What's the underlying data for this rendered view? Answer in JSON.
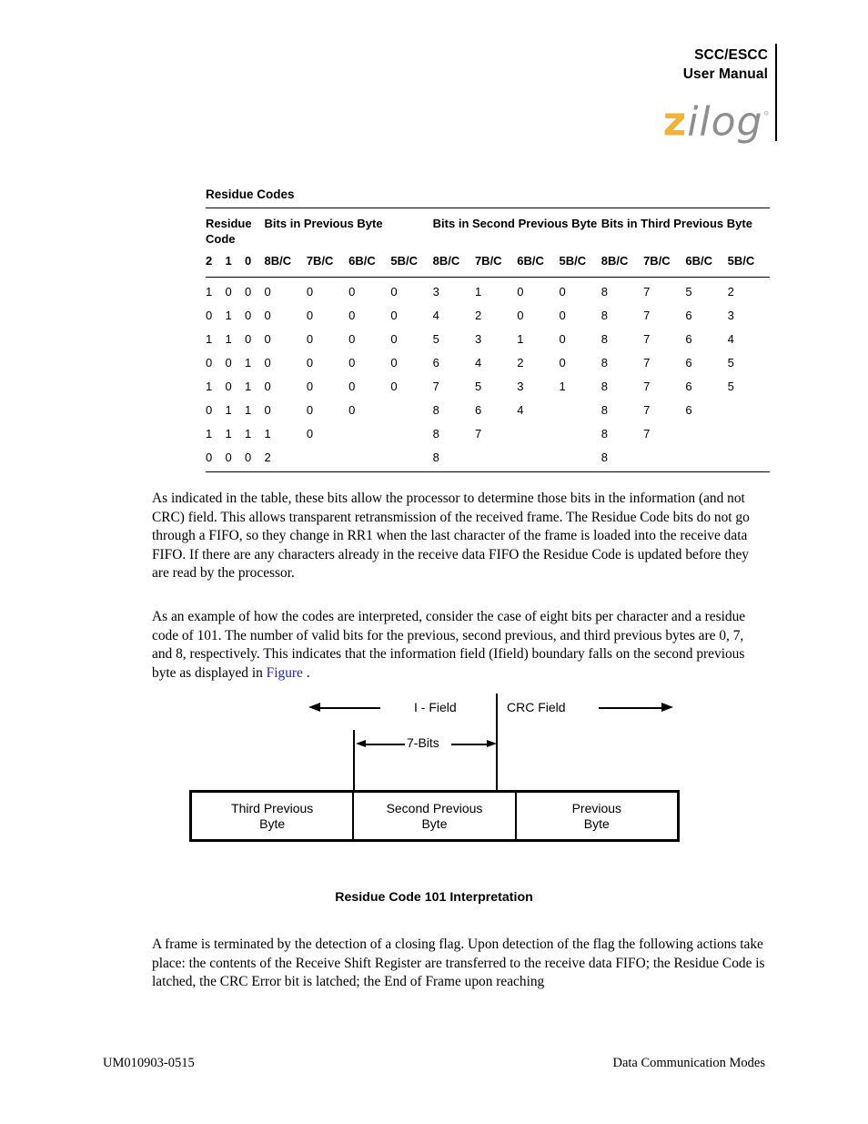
{
  "header": {
    "title_line1": "SCC/ESCC",
    "title_line2": "User Manual",
    "logo_z": "z",
    "logo_rest": "ilog",
    "logo_dot": "°"
  },
  "table": {
    "title": "Residue Codes",
    "group_headers": [
      "Residue Code",
      "Bits in Previous Byte",
      "Bits in Second Previous Byte",
      "Bits in Third Previous Byte"
    ],
    "sub_headers": [
      "2",
      "1",
      "0",
      "8B/C",
      "7B/C",
      "6B/C",
      "5B/C",
      "8B/C",
      "7B/C",
      "6B/C",
      "5B/C",
      "8B/C",
      "7B/C",
      "6B/C",
      "5B/C"
    ],
    "rows": [
      [
        "1",
        "0",
        "0",
        "0",
        "0",
        "0",
        "0",
        "3",
        "1",
        "0",
        "0",
        "8",
        "7",
        "5",
        "2"
      ],
      [
        "0",
        "1",
        "0",
        "0",
        "0",
        "0",
        "0",
        "4",
        "2",
        "0",
        "0",
        "8",
        "7",
        "6",
        "3"
      ],
      [
        "1",
        "1",
        "0",
        "0",
        "0",
        "0",
        "0",
        "5",
        "3",
        "1",
        "0",
        "8",
        "7",
        "6",
        "4"
      ],
      [
        "0",
        "0",
        "1",
        "0",
        "0",
        "0",
        "0",
        "6",
        "4",
        "2",
        "0",
        "8",
        "7",
        "6",
        "5"
      ],
      [
        "1",
        "0",
        "1",
        "0",
        "0",
        "0",
        "0",
        "7",
        "5",
        "3",
        "1",
        "8",
        "7",
        "6",
        "5"
      ],
      [
        "0",
        "1",
        "1",
        "0",
        "0",
        "0",
        "",
        "8",
        "6",
        "4",
        "",
        "8",
        "7",
        "6",
        ""
      ],
      [
        "1",
        "1",
        "1",
        "1",
        "0",
        "",
        "",
        "8",
        "7",
        "",
        "",
        "8",
        "7",
        "",
        ""
      ],
      [
        "0",
        "0",
        "0",
        "2",
        "",
        "",
        "",
        "8",
        "",
        "",
        "",
        "8",
        "",
        "",
        ""
      ]
    ]
  },
  "paragraphs": {
    "p1": "As indicated in the table, these bits allow the processor to determine those bits in the information (and not CRC) field. This allows transparent retransmission of the received frame. The Residue Code bits do not go through a FIFO, so they change in RR1 when the last character of the frame is loaded into the receive data FIFO. If there are any characters already in the receive data FIFO the Residue Code is updated before they are read by the processor.",
    "p2_before_link": "As an example of how the codes are interpreted, consider the case of eight bits per character and a residue code of 101. The number of valid bits for the previous, second previous, and third previous bytes are 0, 7, and 8, respectively. This indicates that the information field (Ifield) boundary falls on the second previous byte as displayed in ",
    "p2_link": "Figure",
    "p2_after_link": " .",
    "p3": "A frame is terminated by the detection of a closing flag. Upon detection of the flag the following actions take place: the contents of the Receive Shift Register are transferred to the receive data FIFO; the Residue Code is latched, the CRC Error bit is latched; the End of Frame upon reaching"
  },
  "diagram": {
    "ifield_label": "I - Field",
    "crc_label": "CRC Field",
    "bits_label": "7-Bits",
    "cells": [
      {
        "line1": "Third Previous",
        "line2": "Byte"
      },
      {
        "line1": "Second Previous",
        "line2": "Byte"
      },
      {
        "line1": "Previous",
        "line2": "Byte"
      }
    ],
    "caption": "Residue Code 101 Interpretation"
  },
  "footer": {
    "left": "UM010903-0515",
    "right": "Data Communication Modes"
  },
  "colors": {
    "logo_z": "#f2b233",
    "logo_text": "#8e8e8e",
    "link": "#2222cc",
    "rule": "#000000"
  }
}
